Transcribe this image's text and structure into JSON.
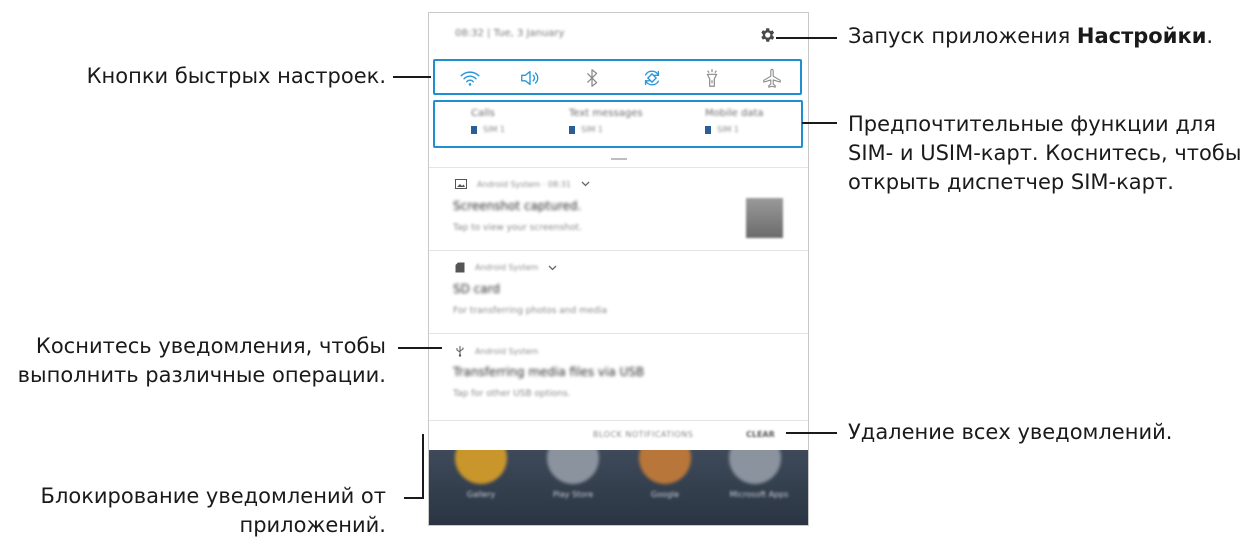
{
  "status_bar": {
    "datetime": "08:32  |  Tue, 3 January",
    "settings_icon": "gear-icon"
  },
  "quick_settings": {
    "icons": [
      "wifi-icon",
      "sound-icon",
      "bluetooth-icon",
      "auto-rotate-icon",
      "flashlight-icon",
      "airplane-mode-icon"
    ],
    "accent_color": "#1e8fd0",
    "active_color": "#2a98d8",
    "inactive_color": "#8a8a8a"
  },
  "sim_prefs": [
    {
      "title": "Calls",
      "sim": "SIM 1"
    },
    {
      "title": "Text messages",
      "sim": "SIM 1"
    },
    {
      "title": "Mobile data",
      "sim": "SIM 1"
    }
  ],
  "notifications": [
    {
      "icon": "image-icon",
      "app": "Android System · 08:31",
      "title": "Screenshot captured.",
      "subtitle": "Tap to view your screenshot."
    },
    {
      "icon": "sd-card-icon",
      "app": "Android System",
      "title": "SD card",
      "subtitle": "For transferring photos and media"
    },
    {
      "icon": "usb-icon",
      "app": "Android System",
      "title": "Transferring media files via USB",
      "subtitle": "Tap for other USB options."
    }
  ],
  "actions": {
    "block": "BLOCK NOTIFICATIONS",
    "clear": "CLEAR"
  },
  "home_apps": [
    "Gallery",
    "Play Store",
    "Google",
    "Microsoft Apps"
  ],
  "callouts": {
    "quick_settings": "Кнопки быстрых настроек.",
    "settings_prefix": "Запуск приложения ",
    "settings_bold": "Настройки",
    "settings_suffix": ".",
    "sim_line1": "Предпочтительные функции для",
    "sim_line2": "SIM- и USIM-карт. Коснитесь, чтобы",
    "sim_line3": "открыть диспетчер SIM-карт.",
    "notif_line1": "Коснитесь уведомления, чтобы",
    "notif_line2": "выполнить различные операции.",
    "clear_all": "Удаление всех уведомлений.",
    "block_line1": "Блокирование уведомлений от",
    "block_line2": "приложений."
  }
}
